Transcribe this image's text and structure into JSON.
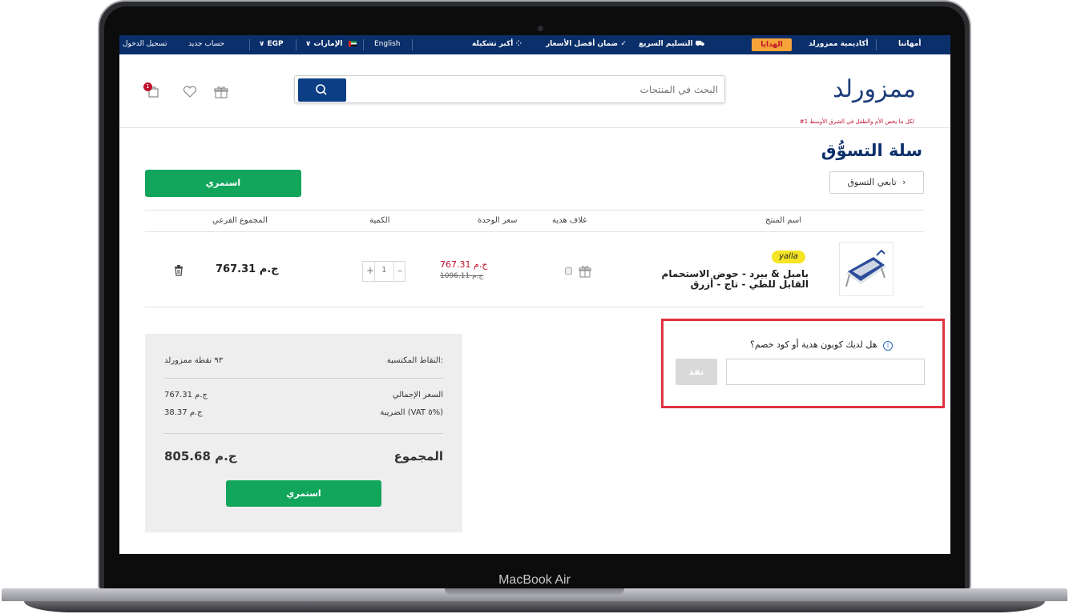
{
  "device": {
    "brand": "MacBook Air"
  },
  "topbar": {
    "mothers": "أمهاتنا",
    "academy": "أكاديمية ممزورلد",
    "gifts": "الهدايا",
    "fast_delivery": "التسليم السريع",
    "best_price": "ضمان أفضل الأسعار",
    "biggest_range": "أكبر تشكيلة",
    "language": "English",
    "country": "الإمارات",
    "currency": "EGP",
    "register": "حساب جديد",
    "login": "تسجيل الدخول"
  },
  "header": {
    "logo_text": "ممزورلد",
    "logo_tagline": "#1 لكل ما يخص الأم والطفل في الشرق الأوسط",
    "search_placeholder": "البحث في المنتجات",
    "cart_count": "1"
  },
  "page": {
    "title": "سلة التسوُّق",
    "continue_shopping": "تابعي التسوق",
    "checkout_label": "استمري"
  },
  "table": {
    "headers": {
      "product_name": "اسم المنتج",
      "gift_wrap": "غلاف هدية",
      "unit_price": "سعر الوحدة",
      "quantity": "الكمية",
      "subtotal": "المجموع الفرعي"
    },
    "items": [
      {
        "badge": "yalla",
        "name": "بامبل & بيرد - حوض الاستحمام القابل للطي - تاج - أزرق",
        "price_new": "767.31 ج.م",
        "price_old": "1096.11 ج.م",
        "quantity": "1",
        "subtotal": "767.31 ج.م"
      }
    ]
  },
  "coupon": {
    "question": "هل لديك كوبون هدية أو كود خصم؟",
    "apply_label": "نفذ",
    "value": ""
  },
  "summary": {
    "points_label": "النقاط المكتسبة:",
    "points_value": "٩٣ نقطة ممزورلد",
    "total_price_label": "السعر الإجمالي",
    "total_price_value": "767.31 ج.م",
    "vat_label": "الضريبة (VAT ٥%)",
    "vat_value": "38.37 ج.م",
    "grand_total_label": "المجموع",
    "grand_total_value": "805.68 ج.م",
    "checkout_label": "استمري"
  },
  "colors": {
    "navy": "#0b2f6b",
    "green": "#12a55c",
    "red_price": "#c0122b",
    "highlight_box": "#e03340"
  }
}
